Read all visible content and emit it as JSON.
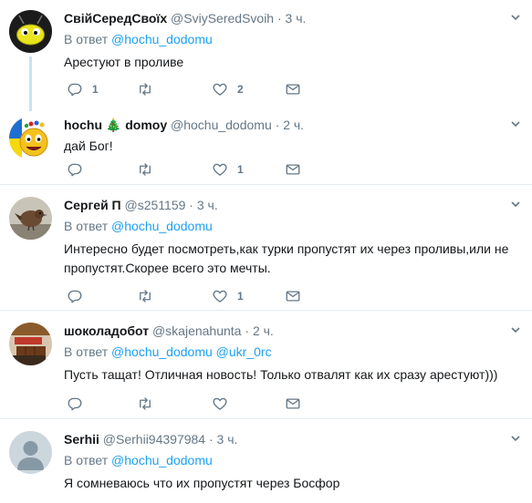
{
  "tweets": [
    {
      "name": "СвійСередСвоїх",
      "handle": "@SviySeredSvoih",
      "dot": "·",
      "time": "3 ч.",
      "reply_label": "В ответ",
      "reply_mentions": [
        "@hochu_dodomu"
      ],
      "text": "Арестуют в проливе",
      "actions": {
        "reply": "1",
        "retweet": "",
        "like": "2"
      },
      "avatar_icon": "bee-avatar-icon"
    },
    {
      "name": "hochu",
      "name_emoji": "🎄",
      "name_rest": "domoy",
      "handle": "@hochu_dodomu",
      "dot": "·",
      "time": "2 ч.",
      "text": "дай  Бог!",
      "actions": {
        "reply": "",
        "retweet": "",
        "like": "1"
      },
      "avatar_icon": "smiley-avatar-icon"
    },
    {
      "name": "Сергей П",
      "handle": "@s251159",
      "dot": "·",
      "time": "3 ч.",
      "reply_label": "В ответ",
      "reply_mentions": [
        "@hochu_dodomu"
      ],
      "text": "Интересно будет посмотреть,как турки пропустят их через проливы,или не пропустят.Скорее всего это мечты.",
      "actions": {
        "reply": "",
        "retweet": "",
        "like": "1"
      },
      "avatar_icon": "bird-avatar-icon"
    },
    {
      "name": "шоколадобот",
      "handle": "@skajenahunta",
      "dot": "·",
      "time": "2 ч.",
      "reply_label": "В ответ",
      "reply_mentions": [
        "@hochu_dodomu",
        "@ukr_0rc"
      ],
      "text": "Пусть тащат! Отличная новость! Только отвалят как их сразу арестуют)))",
      "actions": {
        "reply": "",
        "retweet": "",
        "like": ""
      },
      "avatar_icon": "chocolate-avatar-icon"
    },
    {
      "name": "Serhii",
      "handle": "@Serhii94397984",
      "dot": "·",
      "time": "3 ч.",
      "reply_label": "В ответ",
      "reply_mentions": [
        "@hochu_dodomu"
      ],
      "text": "Я сомневаюсь что их пропустят через Босфор",
      "avatar_icon": "default-user-avatar-icon"
    }
  ],
  "colors": {
    "accent": "#1da1f2",
    "muted": "#657786",
    "text": "#14171a",
    "separator": "#e6ecf0",
    "thread_line": "#c4e3f7"
  }
}
